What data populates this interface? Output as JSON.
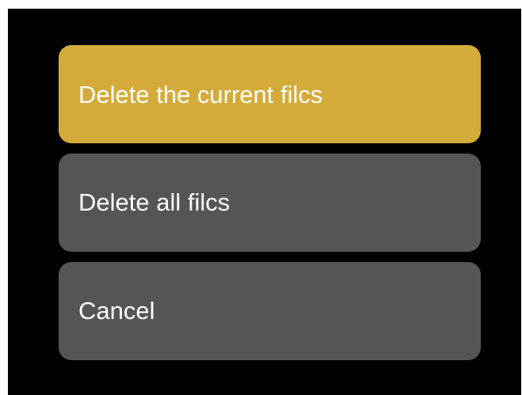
{
  "menu": {
    "options": [
      {
        "label": "Delete the current filcs",
        "selected": true
      },
      {
        "label": "Delete all filcs",
        "selected": false
      },
      {
        "label": "Cancel",
        "selected": false
      }
    ]
  },
  "colors": {
    "screen_background": "#000000",
    "selected_background": "#d4ab3a",
    "option_background": "#545556",
    "text": "#ffffff"
  }
}
